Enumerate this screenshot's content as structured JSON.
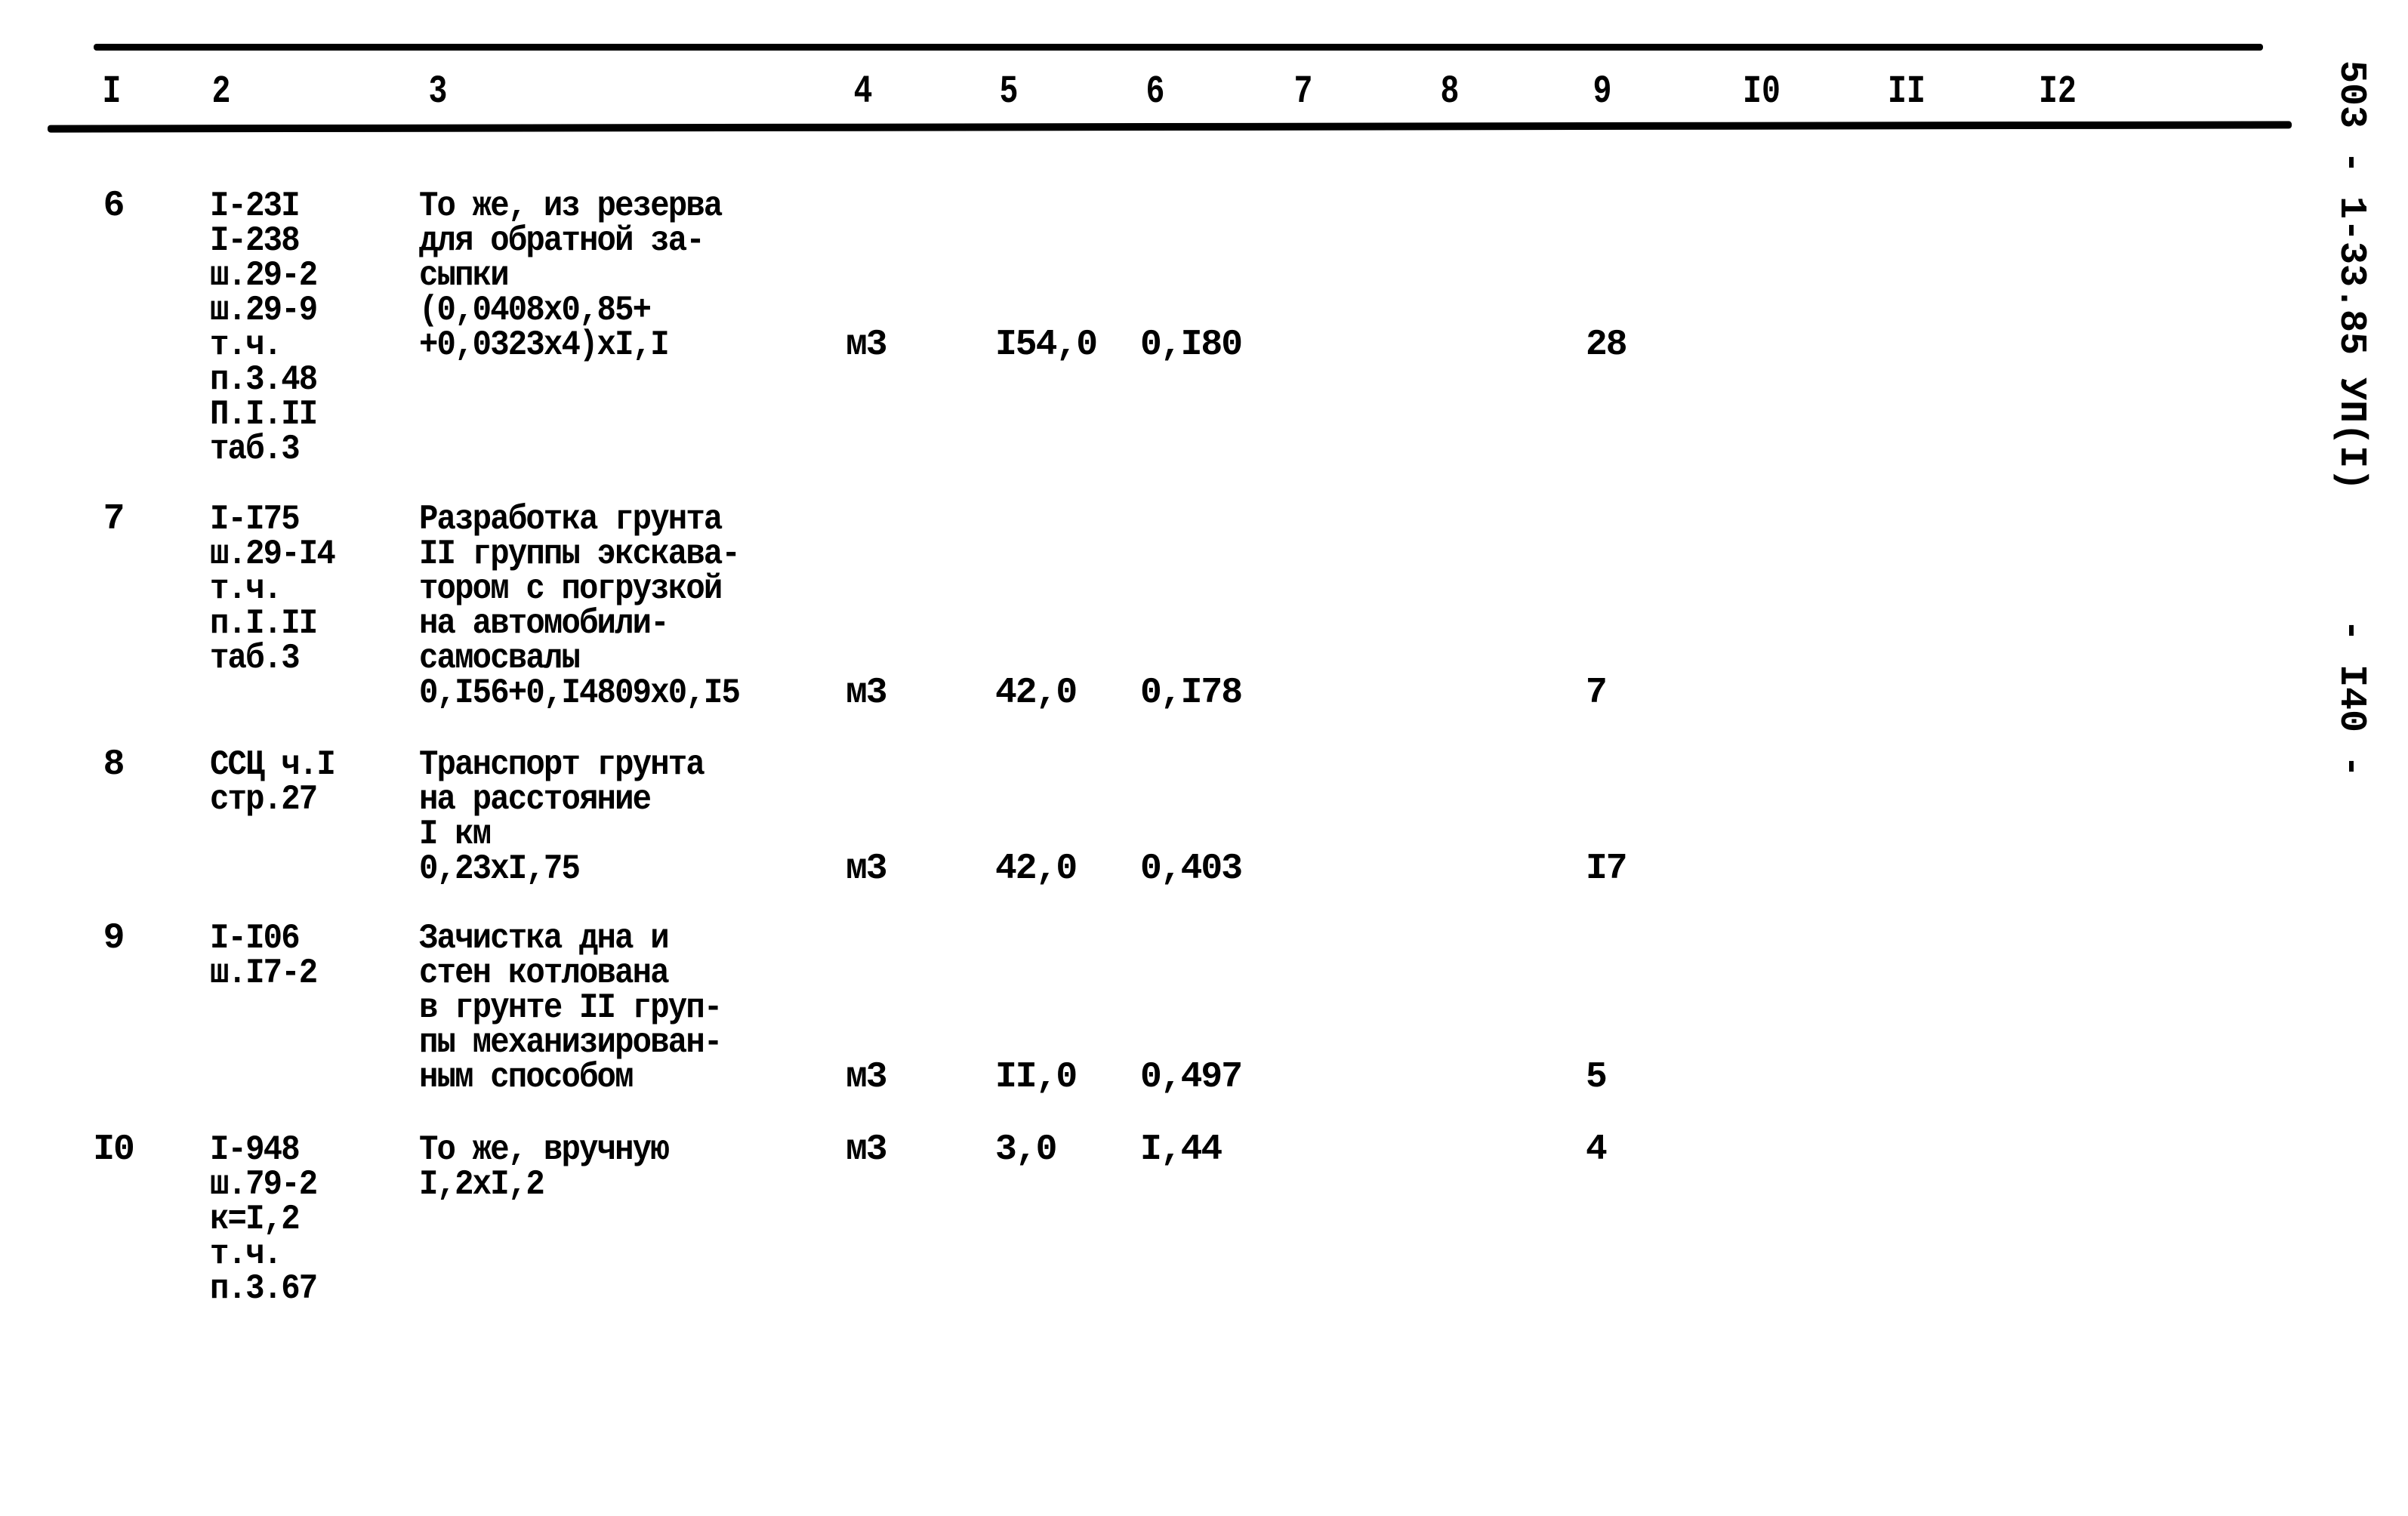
{
  "document": {
    "side_code": "503 - 1-33.85 УП(I)",
    "page_number": "- I40 -"
  },
  "table": {
    "columns": [
      "I",
      "2",
      "3",
      "4",
      "5",
      "6",
      "7",
      "8",
      "9",
      "I0",
      "II",
      "I2"
    ],
    "rows": [
      {
        "num": "6",
        "refs": [
          "I-23I",
          "I-238",
          "ш.29-2",
          "ш.29-9",
          "т.ч.",
          "п.3.48",
          "П.I.II",
          "таб.3"
        ],
        "desc": [
          "То же, из резерва",
          "для обратной за-",
          "сыпки",
          "(0,0408х0,85+",
          "+0,0323х4)хI,I"
        ],
        "unit": "м3",
        "qty": "I54,0",
        "rate": "0,I80",
        "col9": "28"
      },
      {
        "num": "7",
        "refs": [
          "I-I75",
          "ш.29-I4",
          "т.ч.",
          "п.I.II",
          "таб.3"
        ],
        "desc": [
          "Разработка грунта",
          "II группы экскава-",
          "тором с погрузкой",
          "на автомобили-",
          "самосвалы",
          "0,I56+0,I4809х0,I5"
        ],
        "unit": "м3",
        "qty": "42,0",
        "rate": "0,I78",
        "col9": "7"
      },
      {
        "num": "8",
        "refs": [
          "ССЦ ч.I",
          "стр.27"
        ],
        "desc": [
          "Транспорт грунта",
          "на расстояние",
          "I км",
          "0,23хI,75"
        ],
        "unit": "м3",
        "qty": "42,0",
        "rate": "0,403",
        "col9": "I7"
      },
      {
        "num": "9",
        "refs": [
          "I-I06",
          "ш.I7-2"
        ],
        "desc": [
          "Зачистка дна и",
          "стен котлована",
          "в грунте II груп-",
          "пы механизирован-",
          "ным способом"
        ],
        "unit": "м3",
        "qty": "II,0",
        "rate": "0,497",
        "col9": "5"
      },
      {
        "num": "I0",
        "refs": [
          "I-948",
          "ш.79-2",
          "к=I,2",
          "т.ч.",
          "п.3.67"
        ],
        "desc": [
          "То же, вручную",
          "I,2хI,2"
        ],
        "unit": "м3",
        "qty": "3,0",
        "rate": "I,44",
        "col9": "4"
      }
    ]
  }
}
